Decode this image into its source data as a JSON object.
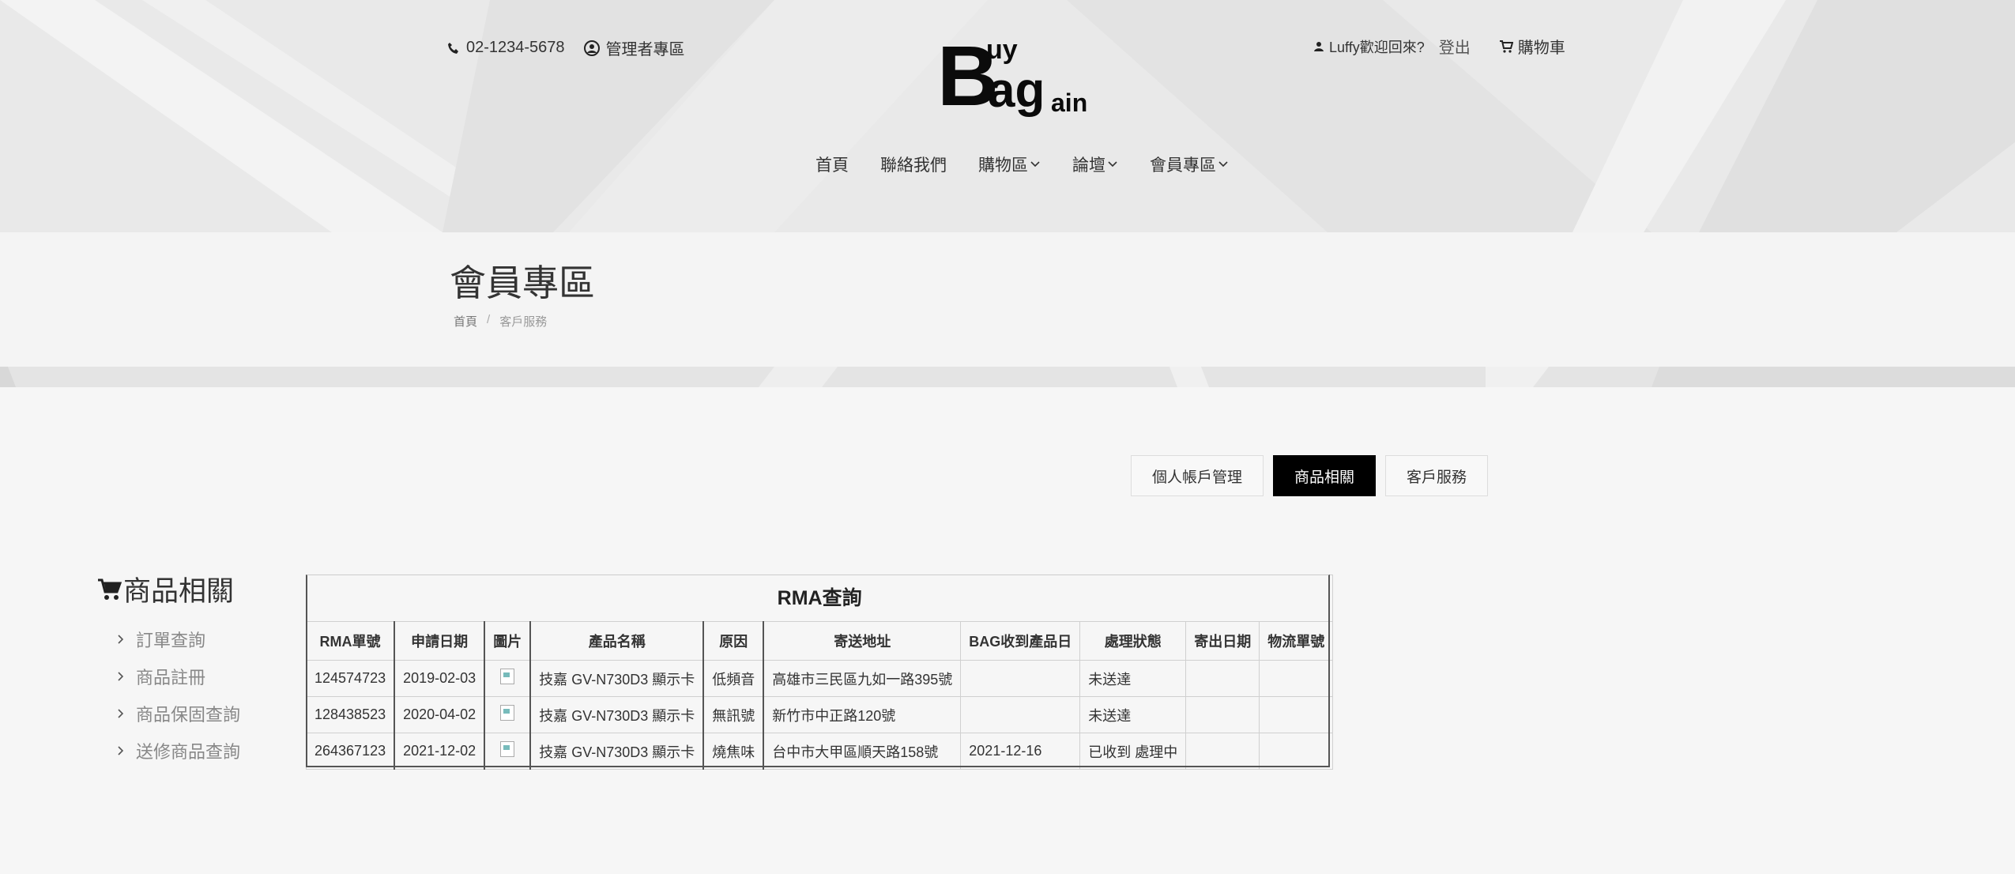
{
  "topbar": {
    "phone": "02-1234-5678",
    "admin_label": "管理者專區",
    "welcome": "Luffy歡迎回來?",
    "logout": "登出",
    "cart": "購物車"
  },
  "logo": {
    "B": "B",
    "uy": "uy",
    "ag": "ag",
    "ain": "ain"
  },
  "nav": {
    "home": "首頁",
    "contact": "聯絡我們",
    "shop": "購物區",
    "forum": "論壇",
    "member": "會員專區"
  },
  "page": {
    "title": "會員專區",
    "breadcrumb_home": "首頁",
    "breadcrumb_sep": "/",
    "breadcrumb_current": "客戶服務"
  },
  "tabs": {
    "account": "個人帳戶管理",
    "products": "商品相關",
    "service": "客戶服務"
  },
  "sidebar": {
    "title": "商品相關",
    "items": [
      "訂單查詢",
      "商品註冊",
      "商品保固查詢",
      "送修商品查詢"
    ]
  },
  "table": {
    "caption": "RMA查詢",
    "headers": [
      "RMA單號",
      "申請日期",
      "圖片",
      "產品名稱",
      "原因",
      "寄送地址",
      "BAG收到產品日",
      "處理狀態",
      "寄出日期",
      "物流單號"
    ],
    "rows": [
      [
        "124574723",
        "2019-02-03",
        "",
        "技嘉 GV-N730D3 顯示卡",
        "低頻音",
        "高雄市三民區九如一路395號",
        "",
        "未送達",
        "",
        ""
      ],
      [
        "128438523",
        "2020-04-02",
        "",
        "技嘉 GV-N730D3 顯示卡",
        "無訊號",
        "新竹市中正路120號",
        "",
        "未送達",
        "",
        ""
      ],
      [
        "264367123",
        "2021-12-02",
        "",
        "技嘉 GV-N730D3 顯示卡",
        "燒焦味",
        "台中市大甲區順天路158號",
        "2021-12-16",
        "已收到 處理中",
        "",
        ""
      ]
    ]
  },
  "colors": {
    "active_tab_bg": "#000000",
    "header_bg": "#e9e9e9",
    "page_bg": "#f6f6f6"
  }
}
